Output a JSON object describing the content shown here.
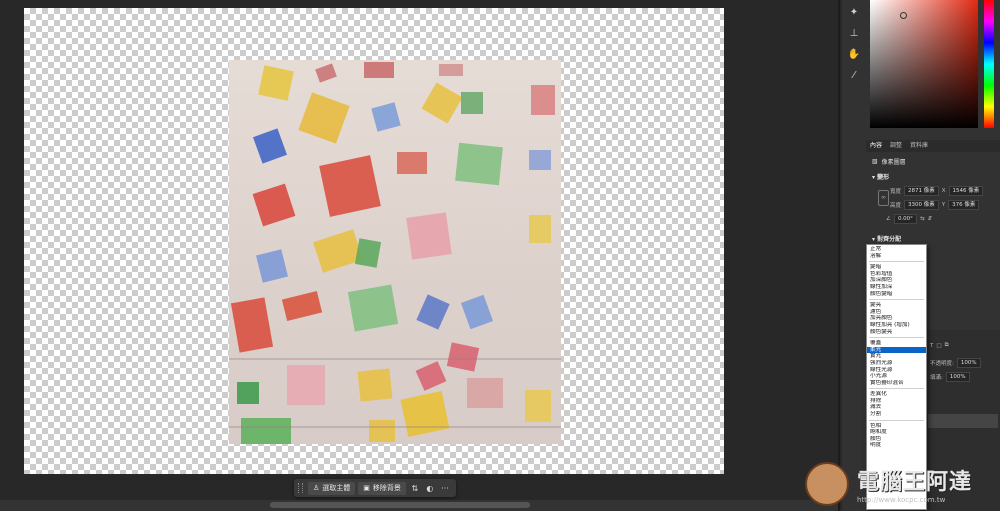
{
  "taskbar": {
    "select_subject": "選取主體",
    "remove_background": "移除背景",
    "more": "···"
  },
  "panel": {
    "tabs": [
      "內容",
      "調整",
      "資料庫"
    ],
    "layer_type": "像素圖層",
    "transform_title": "變形",
    "width_label": "寬度",
    "width_value": "2871 像素",
    "x_label": "X",
    "x_value": "1546 像素",
    "height_label": "高度",
    "height_value": "3300 像素",
    "y_label": "Y",
    "y_value": "376 像素",
    "angle_value": "0.00°",
    "align_title": "對齊分配",
    "opacity_label": "不透明度:",
    "opacity_value": "100%",
    "fill_label": "填滿:",
    "fill_value": "100%"
  },
  "blend_modes": {
    "group1": [
      "正常",
      "溶解"
    ],
    "group2": [
      "變暗",
      "色彩增值",
      "加深顏色",
      "線性加深",
      "顏色變暗"
    ],
    "group3": [
      "變亮",
      "濾色",
      "加亮顏色",
      "線性加亮 (增加)",
      "顏色變亮"
    ],
    "group4": [
      "覆蓋",
      "柔光",
      "實光",
      "強烈光源",
      "線性光源",
      "小光源",
      "實色疊印混合"
    ],
    "group5": [
      "差異化",
      "排除",
      "減去",
      "分割"
    ],
    "group6": [
      "色相",
      "飽和度",
      "顏色",
      "明度"
    ],
    "selected": "柔光"
  },
  "watermark": {
    "title": "電腦王阿達",
    "url": "http://www.kocpc.com.tw"
  }
}
